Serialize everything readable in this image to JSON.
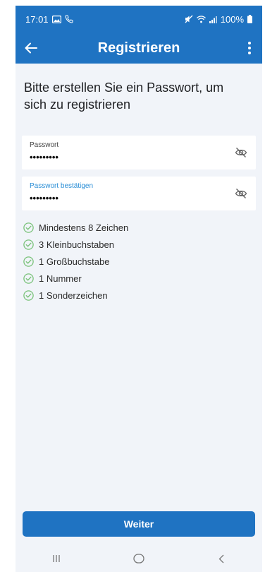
{
  "status_bar": {
    "time": "17:01",
    "battery": "100%",
    "icons": [
      "image-icon",
      "phone-icon",
      "mute-icon",
      "wifi-icon",
      "signal-icon",
      "battery-icon"
    ]
  },
  "app_bar": {
    "title": "Registrieren",
    "back_icon": "arrow-left-icon",
    "menu_icon": "kebab-menu-icon"
  },
  "heading": "Bitte erstellen Sie ein Passwort, um sich zu registrieren",
  "fields": [
    {
      "label": "Passwort",
      "value": "•••••••••",
      "icon": "eye-off-icon"
    },
    {
      "label": "Passwort bestätigen",
      "value": "•••••••••",
      "icon": "eye-off-icon",
      "focused": true
    }
  ],
  "requirements": [
    {
      "text": "Mindestens 8 Zeichen",
      "met": true
    },
    {
      "text": "3 Kleinbuchstaben",
      "met": true
    },
    {
      "text": "1 Großbuchstabe",
      "met": true
    },
    {
      "text": "1 Nummer",
      "met": true
    },
    {
      "text": "1 Sonderzeichen",
      "met": true
    }
  ],
  "button": {
    "label": "Weiter"
  },
  "nav": [
    "recent-apps-icon",
    "home-icon",
    "back-icon"
  ],
  "colors": {
    "primary": "#1f73c2",
    "check": "#7ac27a",
    "background": "#f1f4f9",
    "focus_label": "#2a8ed6"
  }
}
